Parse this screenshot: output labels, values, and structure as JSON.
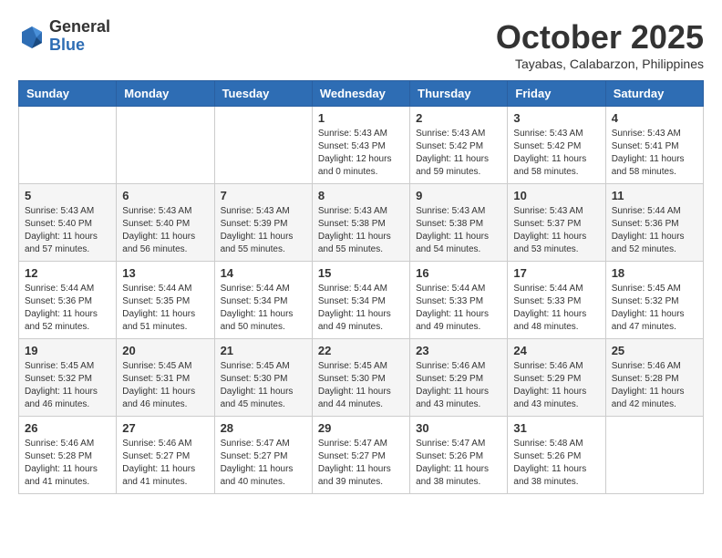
{
  "header": {
    "logo_general": "General",
    "logo_blue": "Blue",
    "month_title": "October 2025",
    "location": "Tayabas, Calabarzon, Philippines"
  },
  "weekdays": [
    "Sunday",
    "Monday",
    "Tuesday",
    "Wednesday",
    "Thursday",
    "Friday",
    "Saturday"
  ],
  "weeks": [
    [
      {
        "day": "",
        "info": ""
      },
      {
        "day": "",
        "info": ""
      },
      {
        "day": "",
        "info": ""
      },
      {
        "day": "1",
        "info": "Sunrise: 5:43 AM\nSunset: 5:43 PM\nDaylight: 12 hours\nand 0 minutes."
      },
      {
        "day": "2",
        "info": "Sunrise: 5:43 AM\nSunset: 5:42 PM\nDaylight: 11 hours\nand 59 minutes."
      },
      {
        "day": "3",
        "info": "Sunrise: 5:43 AM\nSunset: 5:42 PM\nDaylight: 11 hours\nand 58 minutes."
      },
      {
        "day": "4",
        "info": "Sunrise: 5:43 AM\nSunset: 5:41 PM\nDaylight: 11 hours\nand 58 minutes."
      }
    ],
    [
      {
        "day": "5",
        "info": "Sunrise: 5:43 AM\nSunset: 5:40 PM\nDaylight: 11 hours\nand 57 minutes."
      },
      {
        "day": "6",
        "info": "Sunrise: 5:43 AM\nSunset: 5:40 PM\nDaylight: 11 hours\nand 56 minutes."
      },
      {
        "day": "7",
        "info": "Sunrise: 5:43 AM\nSunset: 5:39 PM\nDaylight: 11 hours\nand 55 minutes."
      },
      {
        "day": "8",
        "info": "Sunrise: 5:43 AM\nSunset: 5:38 PM\nDaylight: 11 hours\nand 55 minutes."
      },
      {
        "day": "9",
        "info": "Sunrise: 5:43 AM\nSunset: 5:38 PM\nDaylight: 11 hours\nand 54 minutes."
      },
      {
        "day": "10",
        "info": "Sunrise: 5:43 AM\nSunset: 5:37 PM\nDaylight: 11 hours\nand 53 minutes."
      },
      {
        "day": "11",
        "info": "Sunrise: 5:44 AM\nSunset: 5:36 PM\nDaylight: 11 hours\nand 52 minutes."
      }
    ],
    [
      {
        "day": "12",
        "info": "Sunrise: 5:44 AM\nSunset: 5:36 PM\nDaylight: 11 hours\nand 52 minutes."
      },
      {
        "day": "13",
        "info": "Sunrise: 5:44 AM\nSunset: 5:35 PM\nDaylight: 11 hours\nand 51 minutes."
      },
      {
        "day": "14",
        "info": "Sunrise: 5:44 AM\nSunset: 5:34 PM\nDaylight: 11 hours\nand 50 minutes."
      },
      {
        "day": "15",
        "info": "Sunrise: 5:44 AM\nSunset: 5:34 PM\nDaylight: 11 hours\nand 49 minutes."
      },
      {
        "day": "16",
        "info": "Sunrise: 5:44 AM\nSunset: 5:33 PM\nDaylight: 11 hours\nand 49 minutes."
      },
      {
        "day": "17",
        "info": "Sunrise: 5:44 AM\nSunset: 5:33 PM\nDaylight: 11 hours\nand 48 minutes."
      },
      {
        "day": "18",
        "info": "Sunrise: 5:45 AM\nSunset: 5:32 PM\nDaylight: 11 hours\nand 47 minutes."
      }
    ],
    [
      {
        "day": "19",
        "info": "Sunrise: 5:45 AM\nSunset: 5:32 PM\nDaylight: 11 hours\nand 46 minutes."
      },
      {
        "day": "20",
        "info": "Sunrise: 5:45 AM\nSunset: 5:31 PM\nDaylight: 11 hours\nand 46 minutes."
      },
      {
        "day": "21",
        "info": "Sunrise: 5:45 AM\nSunset: 5:30 PM\nDaylight: 11 hours\nand 45 minutes."
      },
      {
        "day": "22",
        "info": "Sunrise: 5:45 AM\nSunset: 5:30 PM\nDaylight: 11 hours\nand 44 minutes."
      },
      {
        "day": "23",
        "info": "Sunrise: 5:46 AM\nSunset: 5:29 PM\nDaylight: 11 hours\nand 43 minutes."
      },
      {
        "day": "24",
        "info": "Sunrise: 5:46 AM\nSunset: 5:29 PM\nDaylight: 11 hours\nand 43 minutes."
      },
      {
        "day": "25",
        "info": "Sunrise: 5:46 AM\nSunset: 5:28 PM\nDaylight: 11 hours\nand 42 minutes."
      }
    ],
    [
      {
        "day": "26",
        "info": "Sunrise: 5:46 AM\nSunset: 5:28 PM\nDaylight: 11 hours\nand 41 minutes."
      },
      {
        "day": "27",
        "info": "Sunrise: 5:46 AM\nSunset: 5:27 PM\nDaylight: 11 hours\nand 41 minutes."
      },
      {
        "day": "28",
        "info": "Sunrise: 5:47 AM\nSunset: 5:27 PM\nDaylight: 11 hours\nand 40 minutes."
      },
      {
        "day": "29",
        "info": "Sunrise: 5:47 AM\nSunset: 5:27 PM\nDaylight: 11 hours\nand 39 minutes."
      },
      {
        "day": "30",
        "info": "Sunrise: 5:47 AM\nSunset: 5:26 PM\nDaylight: 11 hours\nand 38 minutes."
      },
      {
        "day": "31",
        "info": "Sunrise: 5:48 AM\nSunset: 5:26 PM\nDaylight: 11 hours\nand 38 minutes."
      },
      {
        "day": "",
        "info": ""
      }
    ]
  ]
}
